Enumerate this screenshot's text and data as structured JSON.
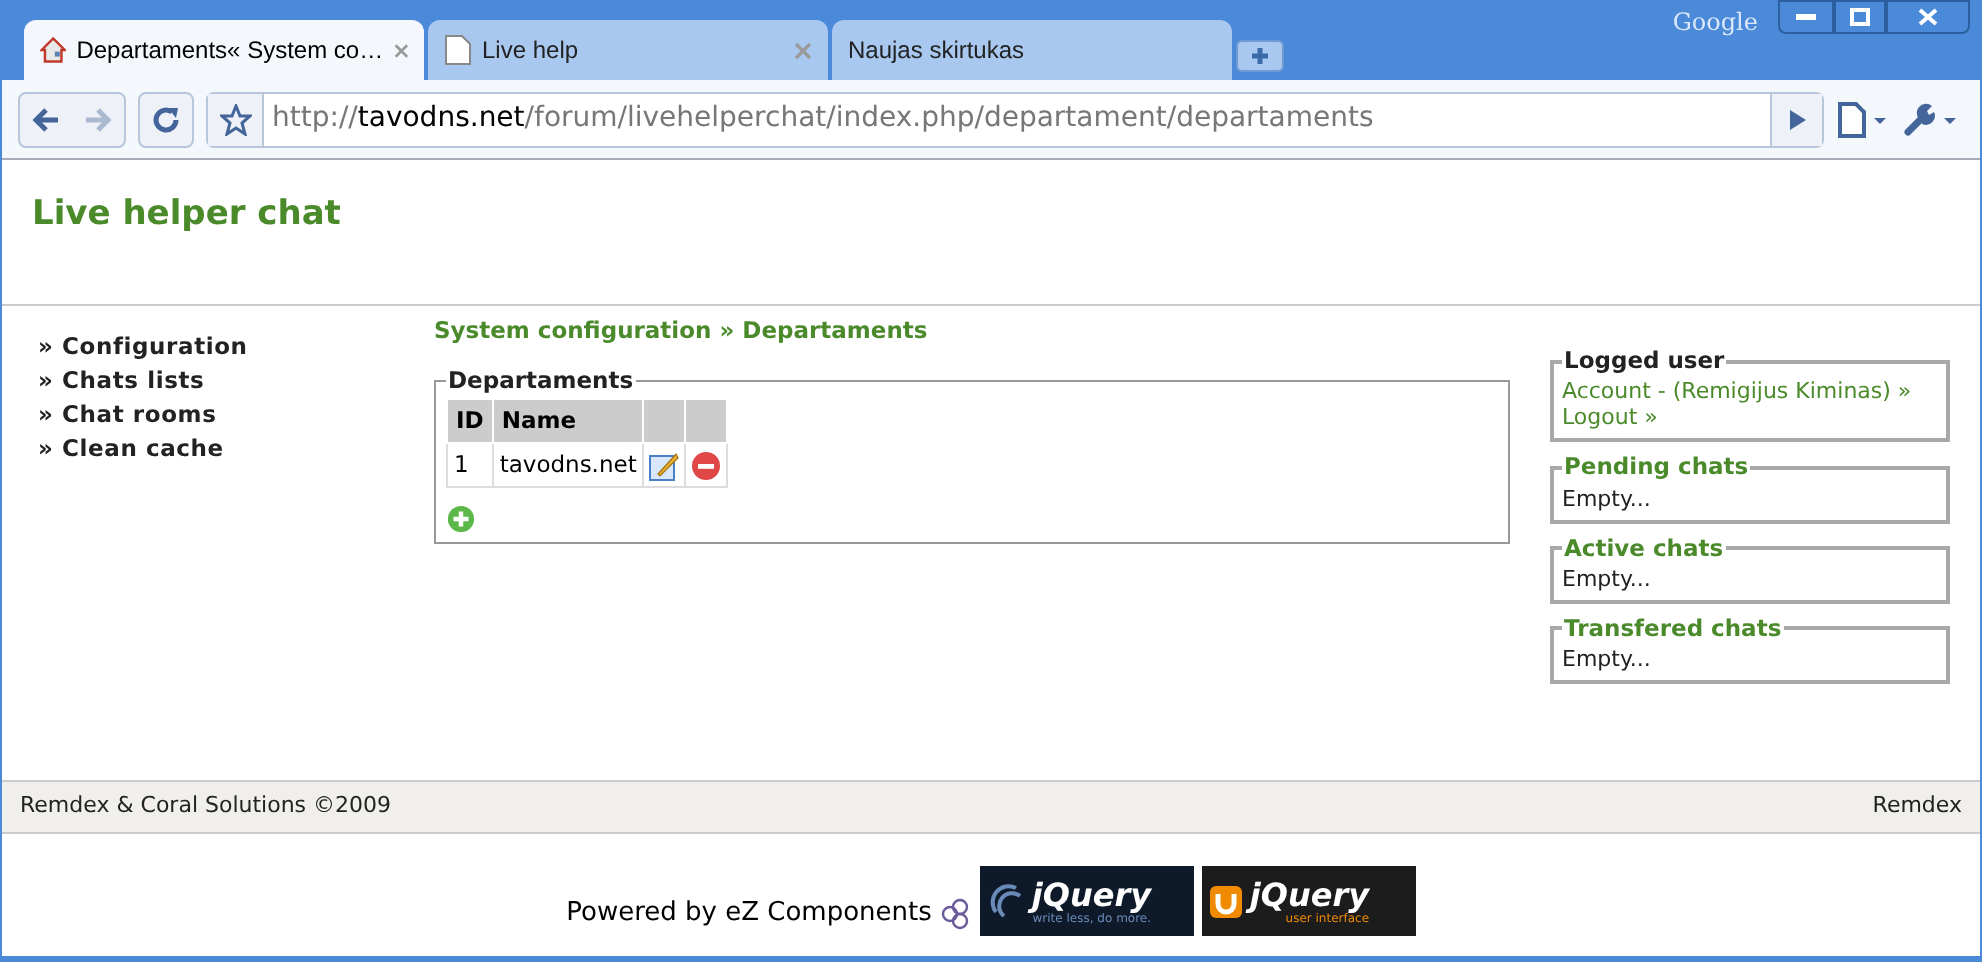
{
  "browser": {
    "brand": "Google",
    "tabs": [
      {
        "title": "Departaments« System co…",
        "selected": true,
        "kind": "home",
        "closable": true
      },
      {
        "title": "Live help",
        "selected": false,
        "kind": "page",
        "closable": true
      },
      {
        "title": "Naujas skirtukas",
        "selected": false,
        "kind": "blank",
        "closable": false
      }
    ],
    "url": {
      "scheme": "http://",
      "host": "tavodns.net",
      "path": "/forum/livehelperchat/index.php/departament/departaments"
    }
  },
  "page": {
    "site_title": "Live helper chat",
    "menu": [
      "Configuration",
      "Chats lists",
      "Chat rooms",
      "Clean cache"
    ],
    "menu_marker": "»",
    "breadcrumb": "System configuration » Departaments",
    "panel_title": "Departaments",
    "table": {
      "columns": [
        "ID",
        "Name"
      ],
      "rows": [
        {
          "id": "1",
          "name": "tavodns.net"
        }
      ]
    },
    "logged_user": {
      "title": "Logged user",
      "links": [
        "Account - (Remigijus Kiminas) »",
        "Logout »"
      ]
    },
    "chat_boxes": [
      {
        "title": "Pending chats",
        "text": "Empty..."
      },
      {
        "title": "Active chats",
        "text": "Empty..."
      },
      {
        "title": "Transfered chats",
        "text": "Empty..."
      }
    ],
    "footer": {
      "left": "Remdex & Coral Solutions ©2009",
      "right": "Remdex"
    },
    "powered_by": "Powered by eZ Components",
    "logos": [
      {
        "name": "jQuery",
        "tagline": "write less, do more.",
        "kind": "core"
      },
      {
        "name": "jQuery",
        "tagline": "user interface",
        "kind": "ui"
      }
    ]
  }
}
